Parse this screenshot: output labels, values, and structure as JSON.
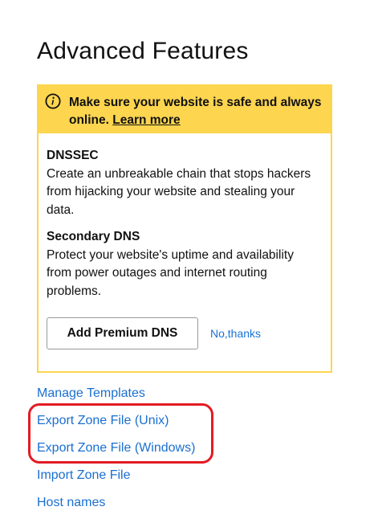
{
  "page": {
    "title": "Advanced Features"
  },
  "notice": {
    "icon": "info-icon",
    "text": "Make sure your website is safe and always online.",
    "link_label": "Learn more"
  },
  "features": [
    {
      "name": "DNSSEC",
      "description": "Create an unbreakable chain that stops hackers from hijacking your website and stealing your data."
    },
    {
      "name": "Secondary DNS",
      "description": "Protect your website's uptime and availability from power outages and internet routing problems."
    }
  ],
  "actions": {
    "primary_label": "Add Premium DNS",
    "decline_label": "No,thanks"
  },
  "links": [
    "Manage Templates",
    "Export Zone File (Unix)",
    "Export Zone File (Windows)",
    "Import Zone File",
    "Host names"
  ],
  "colors": {
    "banner": "#fdd54f",
    "link": "#1a6fd0",
    "highlight": "#e31b23"
  }
}
